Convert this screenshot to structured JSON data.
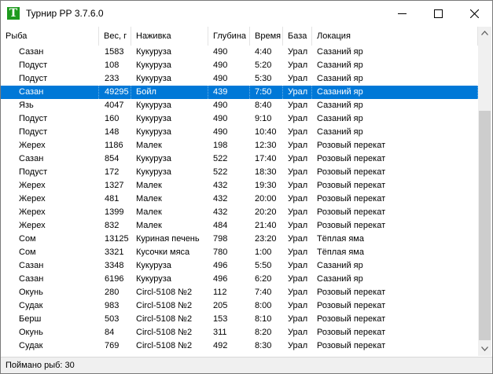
{
  "window": {
    "title": "Турнир РР 3.7.6.0",
    "icon_letter": "T"
  },
  "columns": [
    "Рыба",
    "Вес, г",
    "Наживка",
    "Глубина",
    "Время",
    "База",
    "Локация"
  ],
  "rows": [
    [
      "Сазан",
      "1583",
      "Кукуруза",
      "490",
      "4:40",
      "Урал",
      "Сазаний яр"
    ],
    [
      "Подуст",
      "108",
      "Кукуруза",
      "490",
      "5:20",
      "Урал",
      "Сазаний яр"
    ],
    [
      "Подуст",
      "233",
      "Кукуруза",
      "490",
      "5:30",
      "Урал",
      "Сазаний яр"
    ],
    [
      "Сазан",
      "49295",
      "Бойл",
      "439",
      "7:50",
      "Урал",
      "Сазаний яр"
    ],
    [
      "Язь",
      "4047",
      "Кукуруза",
      "490",
      "8:40",
      "Урал",
      "Сазаний яр"
    ],
    [
      "Подуст",
      "160",
      "Кукуруза",
      "490",
      "9:10",
      "Урал",
      "Сазаний яр"
    ],
    [
      "Подуст",
      "148",
      "Кукуруза",
      "490",
      "10:40",
      "Урал",
      "Сазаний яр"
    ],
    [
      "Жерех",
      "1186",
      "Малек",
      "198",
      "12:30",
      "Урал",
      "Розовый перекат"
    ],
    [
      "Сазан",
      "854",
      "Кукуруза",
      "522",
      "17:40",
      "Урал",
      "Розовый перекат"
    ],
    [
      "Подуст",
      "172",
      "Кукуруза",
      "522",
      "18:30",
      "Урал",
      "Розовый перекат"
    ],
    [
      "Жерех",
      "1327",
      "Малек",
      "432",
      "19:30",
      "Урал",
      "Розовый перекат"
    ],
    [
      "Жерех",
      "481",
      "Малек",
      "432",
      "20:00",
      "Урал",
      "Розовый перекат"
    ],
    [
      "Жерех",
      "1399",
      "Малек",
      "432",
      "20:20",
      "Урал",
      "Розовый перекат"
    ],
    [
      "Жерех",
      "832",
      "Малек",
      "484",
      "21:40",
      "Урал",
      "Розовый перекат"
    ],
    [
      "Сом",
      "13125",
      "Куриная печень",
      "798",
      "23:20",
      "Урал",
      "Тёплая яма"
    ],
    [
      "Сом",
      "3321",
      "Кусочки мяса",
      "780",
      "1:00",
      "Урал",
      "Тёплая яма"
    ],
    [
      "Сазан",
      "3348",
      "Кукуруза",
      "496",
      "5:50",
      "Урал",
      "Сазаний яр"
    ],
    [
      "Сазан",
      "6196",
      "Кукуруза",
      "496",
      "6:20",
      "Урал",
      "Сазаний яр"
    ],
    [
      "Окунь",
      "280",
      "Circl-5108 №2",
      "112",
      "7:40",
      "Урал",
      "Розовый перекат"
    ],
    [
      "Судак",
      "983",
      "Circl-5108 №2",
      "205",
      "8:00",
      "Урал",
      "Розовый перекат"
    ],
    [
      "Берш",
      "503",
      "Circl-5108 №2",
      "153",
      "8:10",
      "Урал",
      "Розовый перекат"
    ],
    [
      "Окунь",
      "84",
      "Circl-5108 №2",
      "311",
      "8:20",
      "Урал",
      "Розовый перекат"
    ],
    [
      "Судак",
      "769",
      "Circl-5108 №2",
      "492",
      "8:30",
      "Урал",
      "Розовый перекат"
    ]
  ],
  "selected_row": 3,
  "status": {
    "text": "Поймано рыб: 30"
  },
  "colors": {
    "selection": "#0078d7",
    "app_icon": "#1e9a1e"
  }
}
